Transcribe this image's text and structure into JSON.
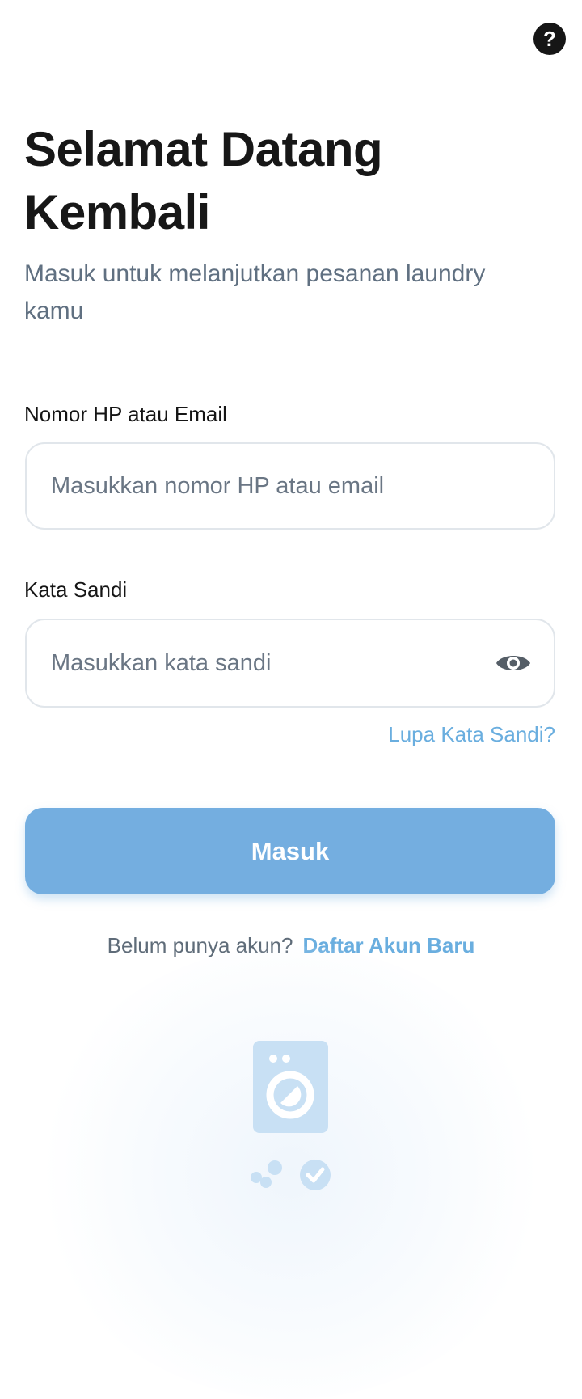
{
  "header": {
    "help_label": "?"
  },
  "hero": {
    "title_line1": "Selamat Datang",
    "title_line2": "Kembali",
    "subtitle": "Masuk untuk melanjutkan pesanan laundry kamu"
  },
  "form": {
    "username": {
      "label": "Nomor HP atau Email",
      "placeholder": "Masukkan nomor HP atau email",
      "value": ""
    },
    "password": {
      "label": "Kata Sandi",
      "placeholder": "Masukkan kata sandi",
      "value": "",
      "toggle_icon": "eye-icon"
    },
    "forgot_label": "Lupa Kata Sandi?",
    "submit_label": "Masuk"
  },
  "signup": {
    "prompt": "Belum punya akun?",
    "link_label": "Daftar Akun Baru"
  },
  "illustration": {
    "icons": [
      "washing-machine-icon",
      "bubbles-icon",
      "check-circle-icon"
    ]
  },
  "colors": {
    "primary": "#74aee0",
    "link": "#6aaedf",
    "title": "#171717",
    "subtitle": "#607081",
    "input_border": "#e1e6eb",
    "help_bg": "#161616",
    "illustration": "#c8e0f4"
  }
}
